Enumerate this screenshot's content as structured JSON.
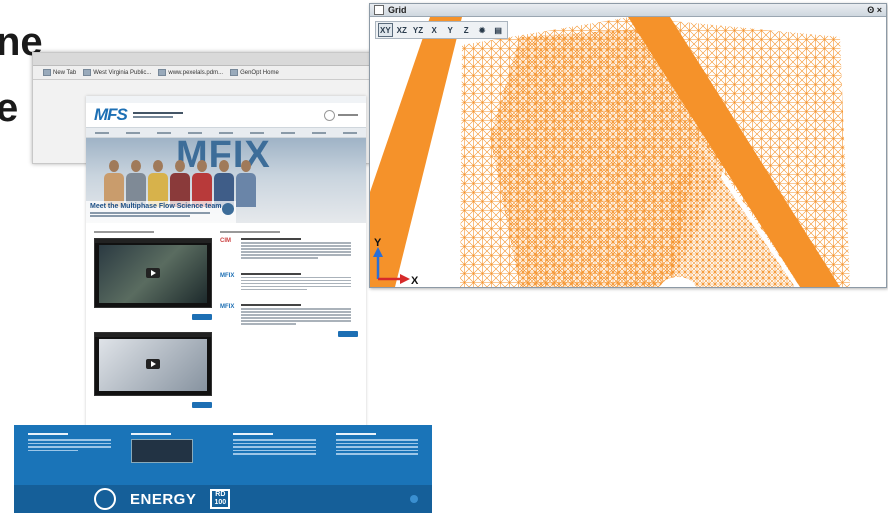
{
  "slide": {
    "text_line1": "ne",
    "text_line2": "e"
  },
  "browser": {
    "bookmarks": [
      "New Tab",
      "West Virginia Public...",
      "www.pexelals.pdm...",
      "GenOpt Home"
    ]
  },
  "mfs_site": {
    "logo": "MFS",
    "hero_word": "MFIX",
    "hero_title": "Meet the Multiphase Flow Science team",
    "news_logos": [
      "CIM",
      "MFIX",
      "MFIX"
    ],
    "footer_energy": "ENERGY",
    "footer_rd": "RD\n100",
    "person_colors": [
      "#c99c6c",
      "#7f8a96",
      "#d7b24b",
      "#8a3a3a",
      "#b83a3a",
      "#3f5d88",
      "#6a85a8"
    ]
  },
  "grid_window": {
    "title": "Grid",
    "controls": "ʘ×",
    "toolbar": [
      {
        "label": "XY",
        "active": true
      },
      {
        "label": "XZ",
        "active": false
      },
      {
        "label": "YZ",
        "active": false
      },
      {
        "label": "X",
        "active": false
      },
      {
        "label": "Y",
        "active": false
      },
      {
        "label": "Z",
        "active": false
      },
      {
        "label": "✹",
        "active": false
      },
      {
        "label": "▤",
        "active": false
      }
    ],
    "axis_y": "Y",
    "axis_x": "X",
    "mesh_color": "#f5922a",
    "axis_y_color": "#2a6fd6",
    "axis_x_color": "#d62a2a"
  }
}
